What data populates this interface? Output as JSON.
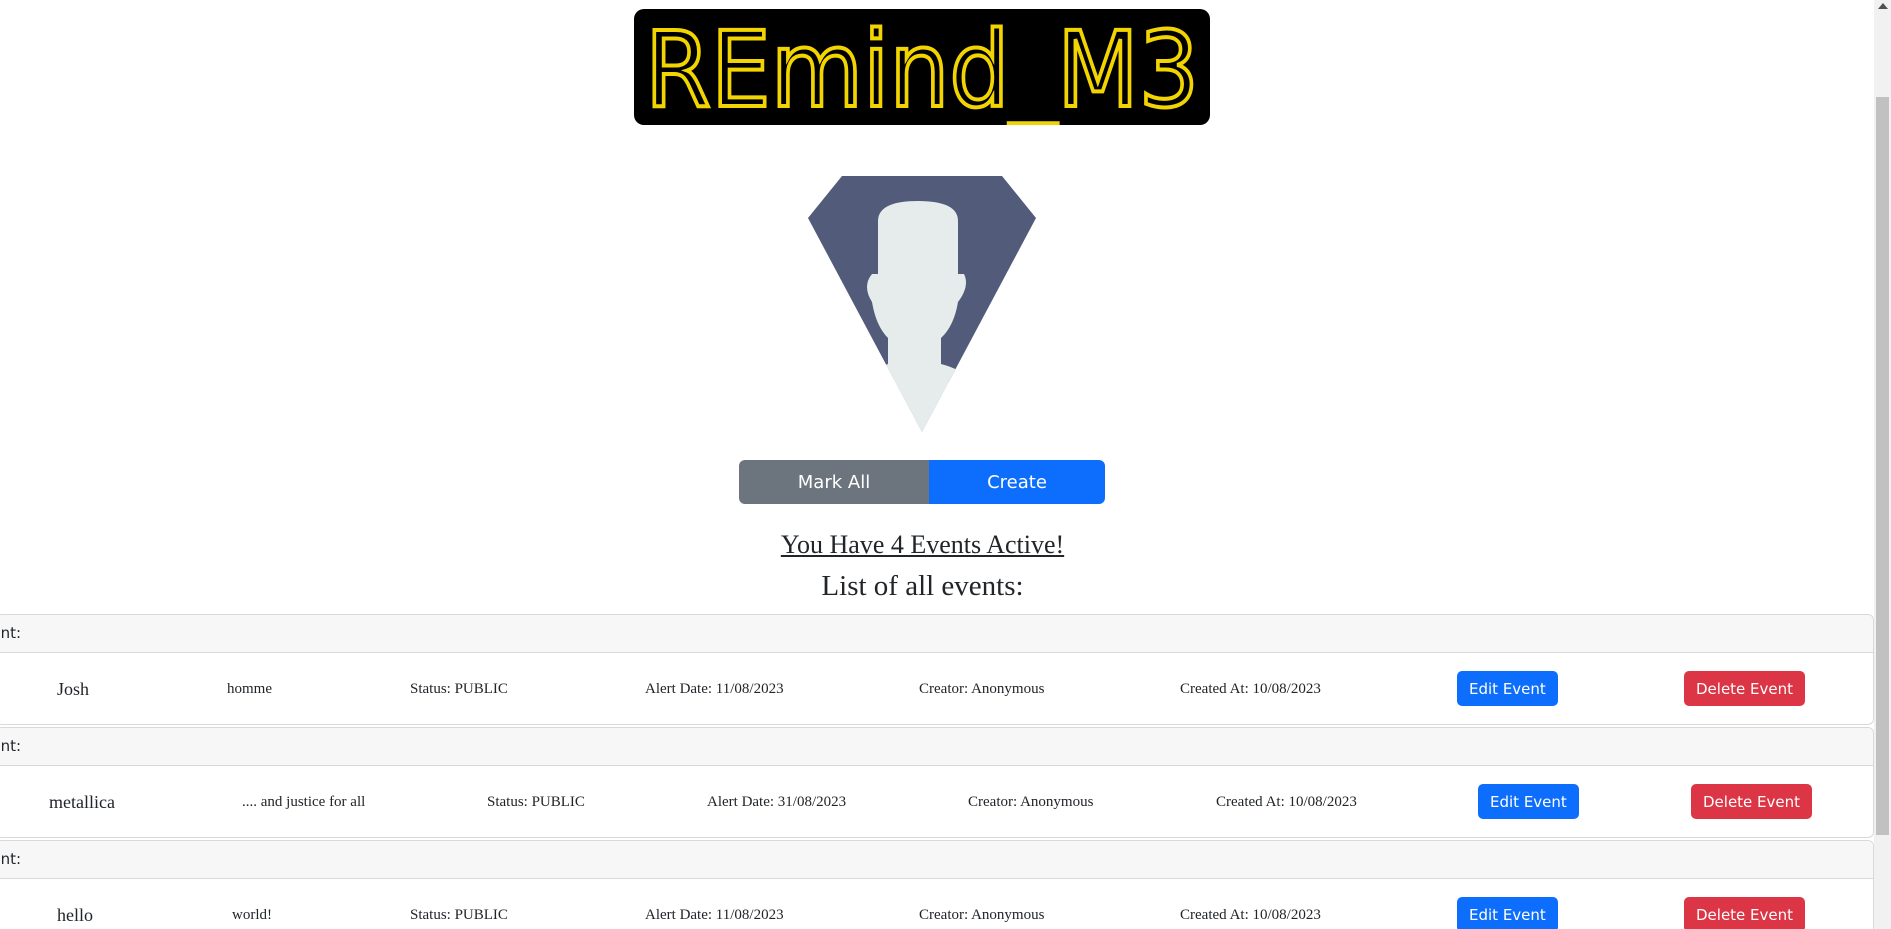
{
  "logo": {
    "text": "REmind_M3"
  },
  "actions": {
    "mark_all": "Mark All",
    "create": "Create"
  },
  "summary": {
    "active_events": "You Have 4 Events Active!",
    "list_title": "List of all events:"
  },
  "events": [
    {
      "header": "Event:",
      "name": "Josh",
      "description": "homme",
      "status": "Status: PUBLIC",
      "alert_date": "Alert Date: 11/08/2023",
      "creator": "Creator: Anonymous",
      "created_at": "Created At: 10/08/2023",
      "edit_label": "Edit Event",
      "delete_label": "Delete Event"
    },
    {
      "header": "Event:",
      "name": "metallica",
      "description": ".... and justice for all",
      "status": "Status: PUBLIC",
      "alert_date": "Alert Date: 31/08/2023",
      "creator": "Creator: Anonymous",
      "created_at": "Created At: 10/08/2023",
      "edit_label": "Edit Event",
      "delete_label": "Delete Event"
    },
    {
      "header": "Event:",
      "name": "hello",
      "description": "world!",
      "status": "Status: PUBLIC",
      "alert_date": "Alert Date: 11/08/2023",
      "creator": "Creator: Anonymous",
      "created_at": "Created At: 10/08/2023",
      "edit_label": "Edit Event",
      "delete_label": "Delete Event"
    }
  ],
  "colors": {
    "logo_bg": "#000000",
    "logo_text": "#f2d500",
    "primary": "#0d6efd",
    "secondary": "#6c757d",
    "danger": "#dc3545",
    "avatar_bg": "#525c7a",
    "avatar_figure": "#e6ebeb"
  }
}
